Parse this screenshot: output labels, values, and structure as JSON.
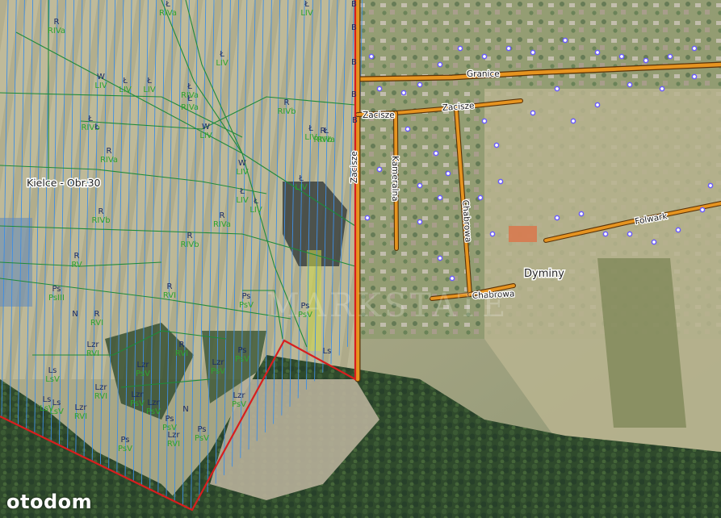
{
  "colors": {
    "road": "#e69420",
    "road_edge": "#5a3208",
    "plot_boundary": "#d81e1e",
    "parcel_lines": "#3d8ee6",
    "class_lines": "#1f8a3a",
    "poi": "#6b5cff"
  },
  "map": {
    "precinct_label": "Kielce - Obr.30",
    "place_name": "Dyminy",
    "roads": [
      {
        "name": "Granice"
      },
      {
        "name": "Zacisze"
      },
      {
        "name": "Zacisze"
      },
      {
        "name": "Zacisze"
      },
      {
        "name": "Kameralna"
      },
      {
        "name": "Chabrowa"
      },
      {
        "name": "Chabrowa"
      },
      {
        "name": "Folwark"
      }
    ],
    "parcel_labels": [
      {
        "use": "Ł",
        "cls": "RIVa"
      },
      {
        "use": "Ł",
        "cls": "LIV"
      },
      {
        "use": "R",
        "cls": "RIVa"
      },
      {
        "use": "Ł",
        "cls": "LIV"
      },
      {
        "use": "Ł",
        "cls": "LIV"
      },
      {
        "use": "W",
        "cls": "LIV"
      },
      {
        "use": "Ł",
        "cls": "RIVa"
      },
      {
        "use": "R",
        "cls": "RIVb"
      },
      {
        "use": "Ł",
        "cls": "LIV"
      },
      {
        "use": "Ł",
        "cls": "RIVa"
      },
      {
        "use": "Ł",
        "cls": "LIV"
      },
      {
        "use": "W",
        "cls": "LIV"
      },
      {
        "use": "R",
        "cls": "RIVb"
      },
      {
        "use": "Ł",
        "cls": "RIVb"
      },
      {
        "use": "Ł",
        "cls": ""
      },
      {
        "use": "R",
        "cls": "RIVa"
      },
      {
        "use": "W",
        "cls": "LIV"
      },
      {
        "use": "Ł",
        "cls": "LIV"
      },
      {
        "use": "R",
        "cls": "RIVb"
      },
      {
        "use": "R",
        "cls": "RIVa"
      },
      {
        "use": "R",
        "cls": "RIVb"
      },
      {
        "use": "R",
        "cls": "RV"
      },
      {
        "use": "R",
        "cls": "RVI"
      },
      {
        "use": "Ps",
        "cls": "PsIII"
      },
      {
        "use": "N",
        "cls": ""
      },
      {
        "use": "R",
        "cls": "RVI"
      },
      {
        "use": "Ps",
        "cls": "PsV"
      },
      {
        "use": "Ps",
        "cls": "PsV"
      },
      {
        "use": "R",
        "cls": "RVI"
      },
      {
        "use": "Lzr",
        "cls": "RVI"
      },
      {
        "use": "Lzr",
        "cls": "PsV"
      },
      {
        "use": "Ps",
        "cls": "PsV"
      },
      {
        "use": "Ls",
        "cls": "LsV"
      },
      {
        "use": "Lzr",
        "cls": "PsV"
      },
      {
        "use": "Lzr",
        "cls": "RVI"
      },
      {
        "use": "Lzr",
        "cls": "PsV"
      },
      {
        "use": "Lzr",
        "cls": "PsV"
      },
      {
        "use": "Ls",
        "cls": "LsV"
      },
      {
        "use": "Lzr",
        "cls": "RVI"
      },
      {
        "use": "N",
        "cls": ""
      },
      {
        "use": "Ps",
        "cls": "PsV"
      },
      {
        "use": "Lzr",
        "cls": "RVI"
      },
      {
        "use": "Ps",
        "cls": "PsV"
      },
      {
        "use": "Ls",
        "cls": "LsV"
      },
      {
        "use": "Ps",
        "cls": "PsV"
      },
      {
        "use": "Ls",
        "cls": ""
      },
      {
        "use": "Lzr",
        "cls": "PsV"
      },
      {
        "use": "Ł",
        "cls": "LIV"
      },
      {
        "use": "Ł",
        "cls": "LIV"
      },
      {
        "use": "Ł",
        "cls": "RIVa"
      }
    ],
    "b_markers": [
      "B",
      "B",
      "B",
      "B",
      "B",
      "B"
    ],
    "watermark": "MARKSTATE"
  },
  "brand": {
    "logo": "otodom"
  }
}
